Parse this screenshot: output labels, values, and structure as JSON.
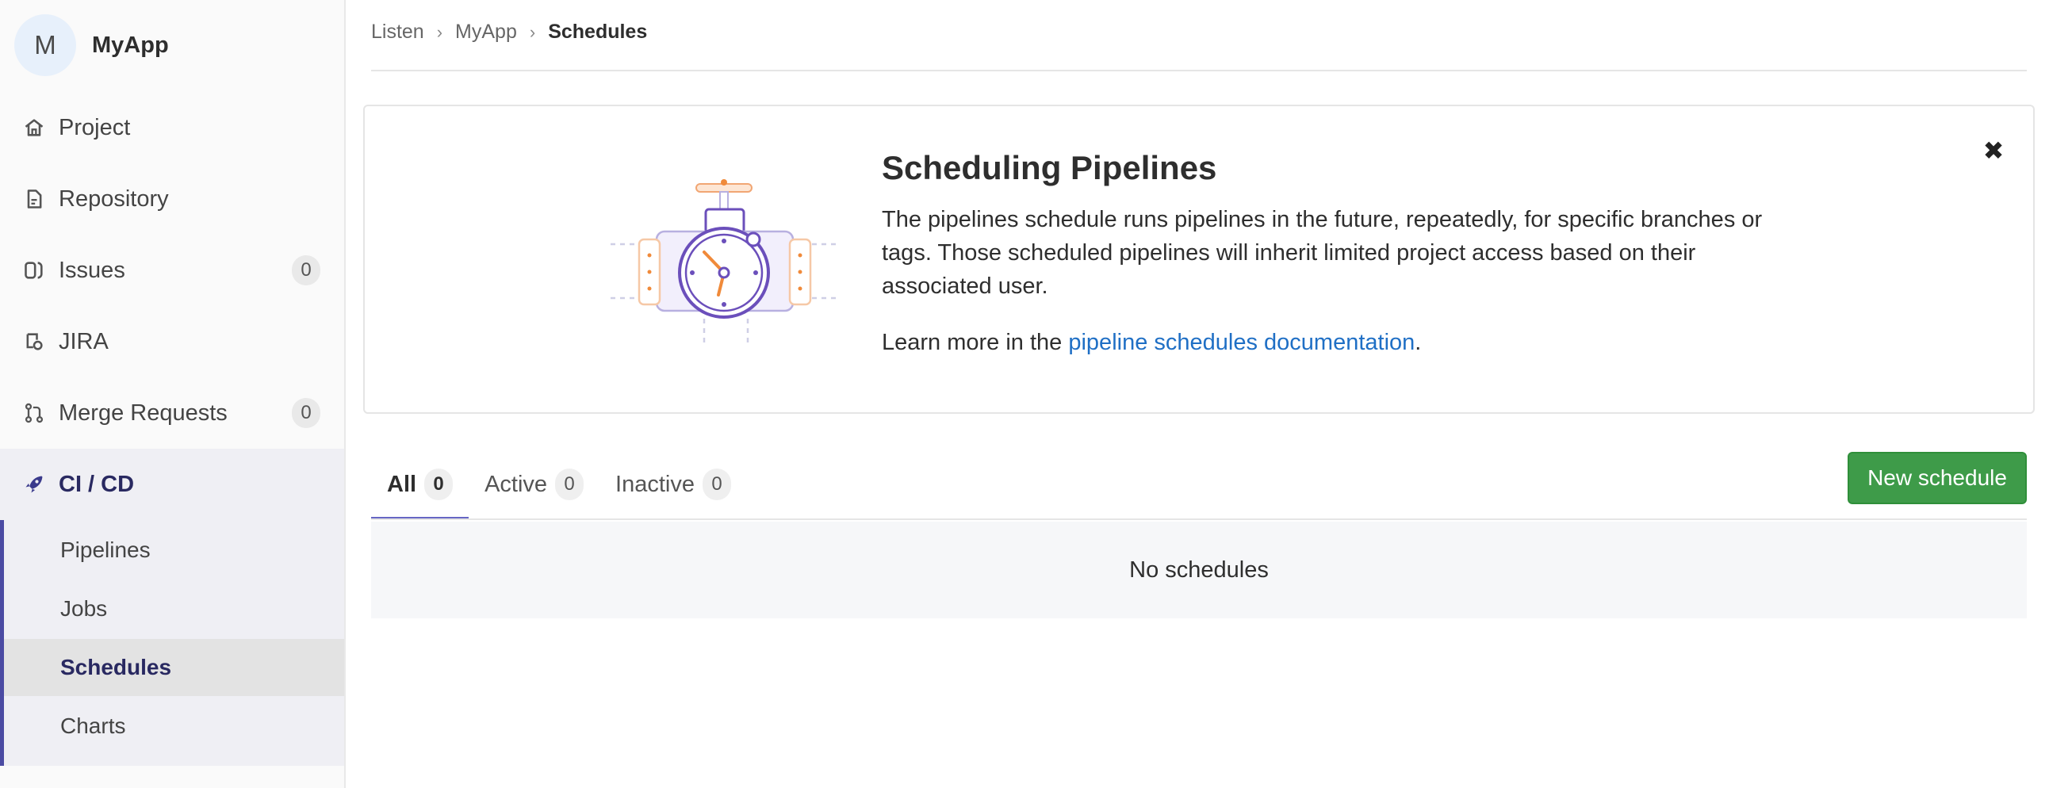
{
  "app": {
    "avatar_letter": "M",
    "name": "MyApp"
  },
  "sidebar": {
    "items": [
      {
        "label": "Project",
        "icon": "home-icon"
      },
      {
        "label": "Repository",
        "icon": "document-icon"
      },
      {
        "label": "Issues",
        "icon": "issues-icon",
        "badge": "0"
      },
      {
        "label": "JIRA",
        "icon": "jira-icon"
      },
      {
        "label": "Merge Requests",
        "icon": "merge-request-icon",
        "badge": "0"
      },
      {
        "label": "CI / CD",
        "icon": "rocket-icon"
      }
    ],
    "sub_items": [
      "Pipelines",
      "Jobs",
      "Schedules",
      "Charts"
    ]
  },
  "breadcrumb": {
    "items": [
      "Listen",
      "MyApp",
      "Schedules"
    ]
  },
  "banner": {
    "title": "Scheduling Pipelines",
    "text": "The pipelines schedule runs pipelines in the future, repeatedly, for specific branches or tags. Those scheduled pipelines will inherit limited project access based on their associated user.",
    "learn_prefix": "Learn more in the ",
    "learn_link": "pipeline schedules documentation",
    "learn_suffix": ".",
    "close_symbol": "✖"
  },
  "tabs": [
    {
      "label": "All",
      "count": "0"
    },
    {
      "label": "Active",
      "count": "0"
    },
    {
      "label": "Inactive",
      "count": "0"
    }
  ],
  "new_schedule_label": "New schedule",
  "empty_text": "No schedules",
  "colors": {
    "accent": "#4b4ba3",
    "button_green": "#3e9b49",
    "link": "#1f6fc5"
  }
}
